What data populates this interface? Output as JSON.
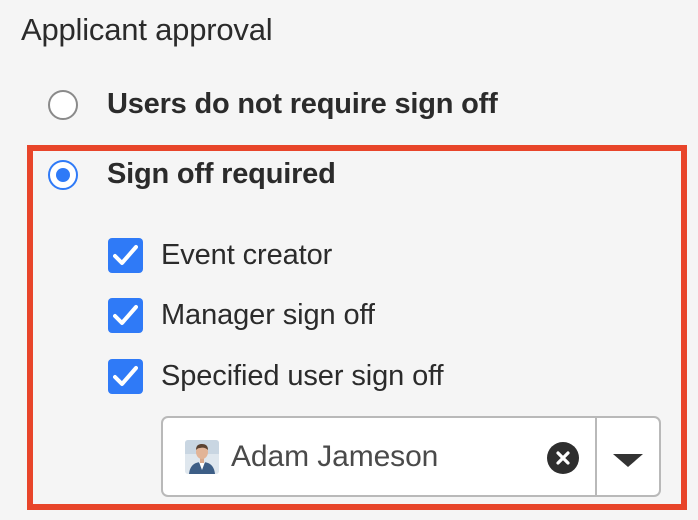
{
  "section": {
    "title": "Applicant approval"
  },
  "approval_options": [
    {
      "label": "Users do not require sign off",
      "selected": false
    },
    {
      "label": "Sign off required",
      "selected": true
    }
  ],
  "sign_off_checks": [
    {
      "label": "Event creator",
      "checked": true
    },
    {
      "label": "Manager sign off",
      "checked": true
    },
    {
      "label": "Specified user sign off",
      "checked": true
    }
  ],
  "specified_user": {
    "name": "Adam Jameson",
    "avatar_icon": "user-avatar-photo"
  },
  "colors": {
    "accent": "#2f7af7",
    "highlight_border": "#e8452a",
    "text": "#2b2b2b"
  }
}
